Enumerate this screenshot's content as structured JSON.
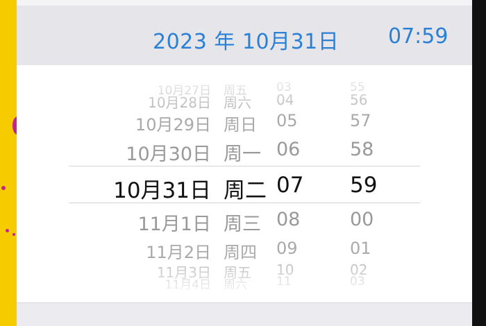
{
  "header": {
    "date_label": "2023 年 10月31日",
    "time_label": "07:59"
  },
  "picker": {
    "rows": [
      {
        "date": "10月27日",
        "weekday": "周五",
        "hour": "03",
        "minute": "55"
      },
      {
        "date": "10月28日",
        "weekday": "周六",
        "hour": "04",
        "minute": "56"
      },
      {
        "date": "10月29日",
        "weekday": "周日",
        "hour": "05",
        "minute": "57"
      },
      {
        "date": "10月30日",
        "weekday": "周一",
        "hour": "06",
        "minute": "58"
      },
      {
        "date": "10月31日",
        "weekday": "周二",
        "hour": "07",
        "minute": "59"
      },
      {
        "date": "11月1日",
        "weekday": "周三",
        "hour": "08",
        "minute": "00"
      },
      {
        "date": "11月2日",
        "weekday": "周四",
        "hour": "09",
        "minute": "01"
      },
      {
        "date": "11月3日",
        "weekday": "周五",
        "hour": "10",
        "minute": "02"
      },
      {
        "date": "11月4日",
        "weekday": "周六",
        "hour": "11",
        "minute": "03"
      }
    ],
    "selected_index": 4
  }
}
